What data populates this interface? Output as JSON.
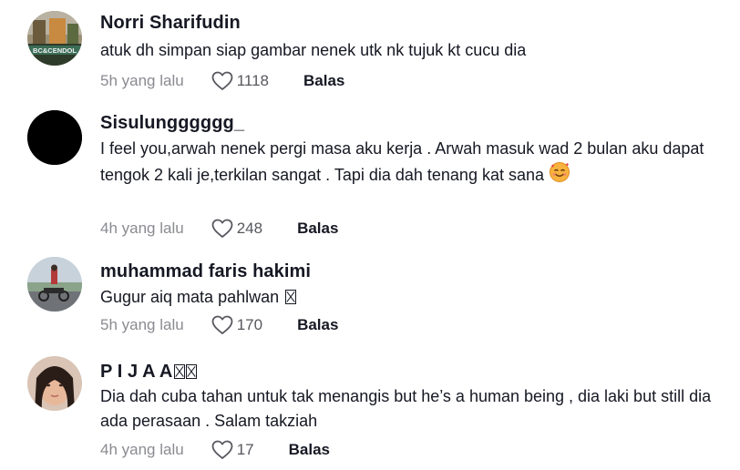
{
  "comments": [
    {
      "username": "Norri Sharifudin",
      "text": "atuk dh simpan siap gambar nenek utk nk tujuk kt cucu dia",
      "time": "5h yang lalu",
      "likes": "1118",
      "reply": "Balas",
      "avatar_label": "BC&CENDOL"
    },
    {
      "username": "Sisulungggggg_",
      "text": "I feel you,arwah nenek pergi masa aku kerja . Arwah masuk wad 2 bulan aku dapat tengok 2 kali je,terkilan sangat . Tapi dia dah tenang kat sana",
      "time": "4h yang lalu",
      "likes": "248",
      "reply": "Balas"
    },
    {
      "username": "muhammad faris hakimi",
      "text": "Gugur aiq mata pahlwan",
      "time": "5h yang lalu",
      "likes": "170",
      "reply": "Balas"
    },
    {
      "username": "P I J A A",
      "text": "Dia dah cuba tahan untuk tak menangis but he’s a human being , dia laki but still dia ada perasaan . Salam takziah",
      "time": "4h yang lalu",
      "likes": "17",
      "reply": "Balas"
    }
  ],
  "colors": {
    "primary_text": "#161823",
    "secondary_text": "#8a8b91",
    "background": "#ffffff"
  }
}
